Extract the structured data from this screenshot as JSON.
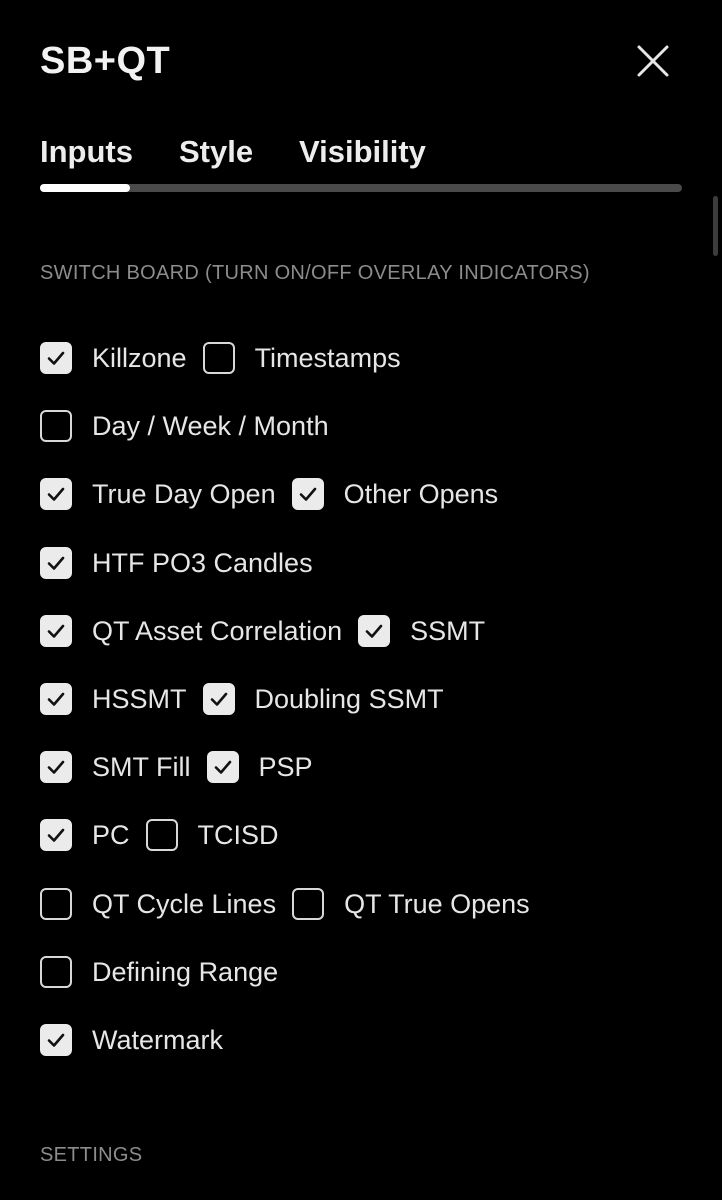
{
  "dialog": {
    "title": "SB+QT",
    "close_icon": "close-icon"
  },
  "tabs": [
    {
      "label": "Inputs",
      "active": true
    },
    {
      "label": "Style",
      "active": false
    },
    {
      "label": "Visibility",
      "active": false
    }
  ],
  "switch_board": {
    "heading": "SWITCH BOARD (TURN ON/OFF OVERLAY INDICATORS)",
    "rows": [
      [
        {
          "label": "Killzone",
          "checked": true
        },
        {
          "label": "Timestamps",
          "checked": false
        }
      ],
      [
        {
          "label": "Day / Week / Month",
          "checked": false
        }
      ],
      [
        {
          "label": "True Day Open",
          "checked": true
        },
        {
          "label": "Other Opens",
          "checked": true
        }
      ],
      [
        {
          "label": "HTF PO3 Candles",
          "checked": true
        }
      ],
      [
        {
          "label": "QT Asset Correlation",
          "checked": true
        },
        {
          "label": "SSMT",
          "checked": true
        }
      ],
      [
        {
          "label": "HSSMT",
          "checked": true
        },
        {
          "label": "Doubling SSMT",
          "checked": true
        }
      ],
      [
        {
          "label": "SMT Fill",
          "checked": true
        },
        {
          "label": "PSP",
          "checked": true
        }
      ],
      [
        {
          "label": "PC",
          "checked": true
        },
        {
          "label": "TCISD",
          "checked": false
        }
      ],
      [
        {
          "label": "QT Cycle Lines",
          "checked": false
        },
        {
          "label": "QT True Opens",
          "checked": false
        }
      ],
      [
        {
          "label": "Defining Range",
          "checked": false
        }
      ],
      [
        {
          "label": "Watermark",
          "checked": true
        }
      ]
    ]
  },
  "settings": {
    "heading": "SETTINGS"
  },
  "colors": {
    "background": "#000000",
    "checkbox_fill": "#ebebeb",
    "check_mark": "#111111",
    "tab_track": "#4a4a4a",
    "tab_indicator": "#ffffff",
    "section_heading": "#8c8c8c"
  }
}
